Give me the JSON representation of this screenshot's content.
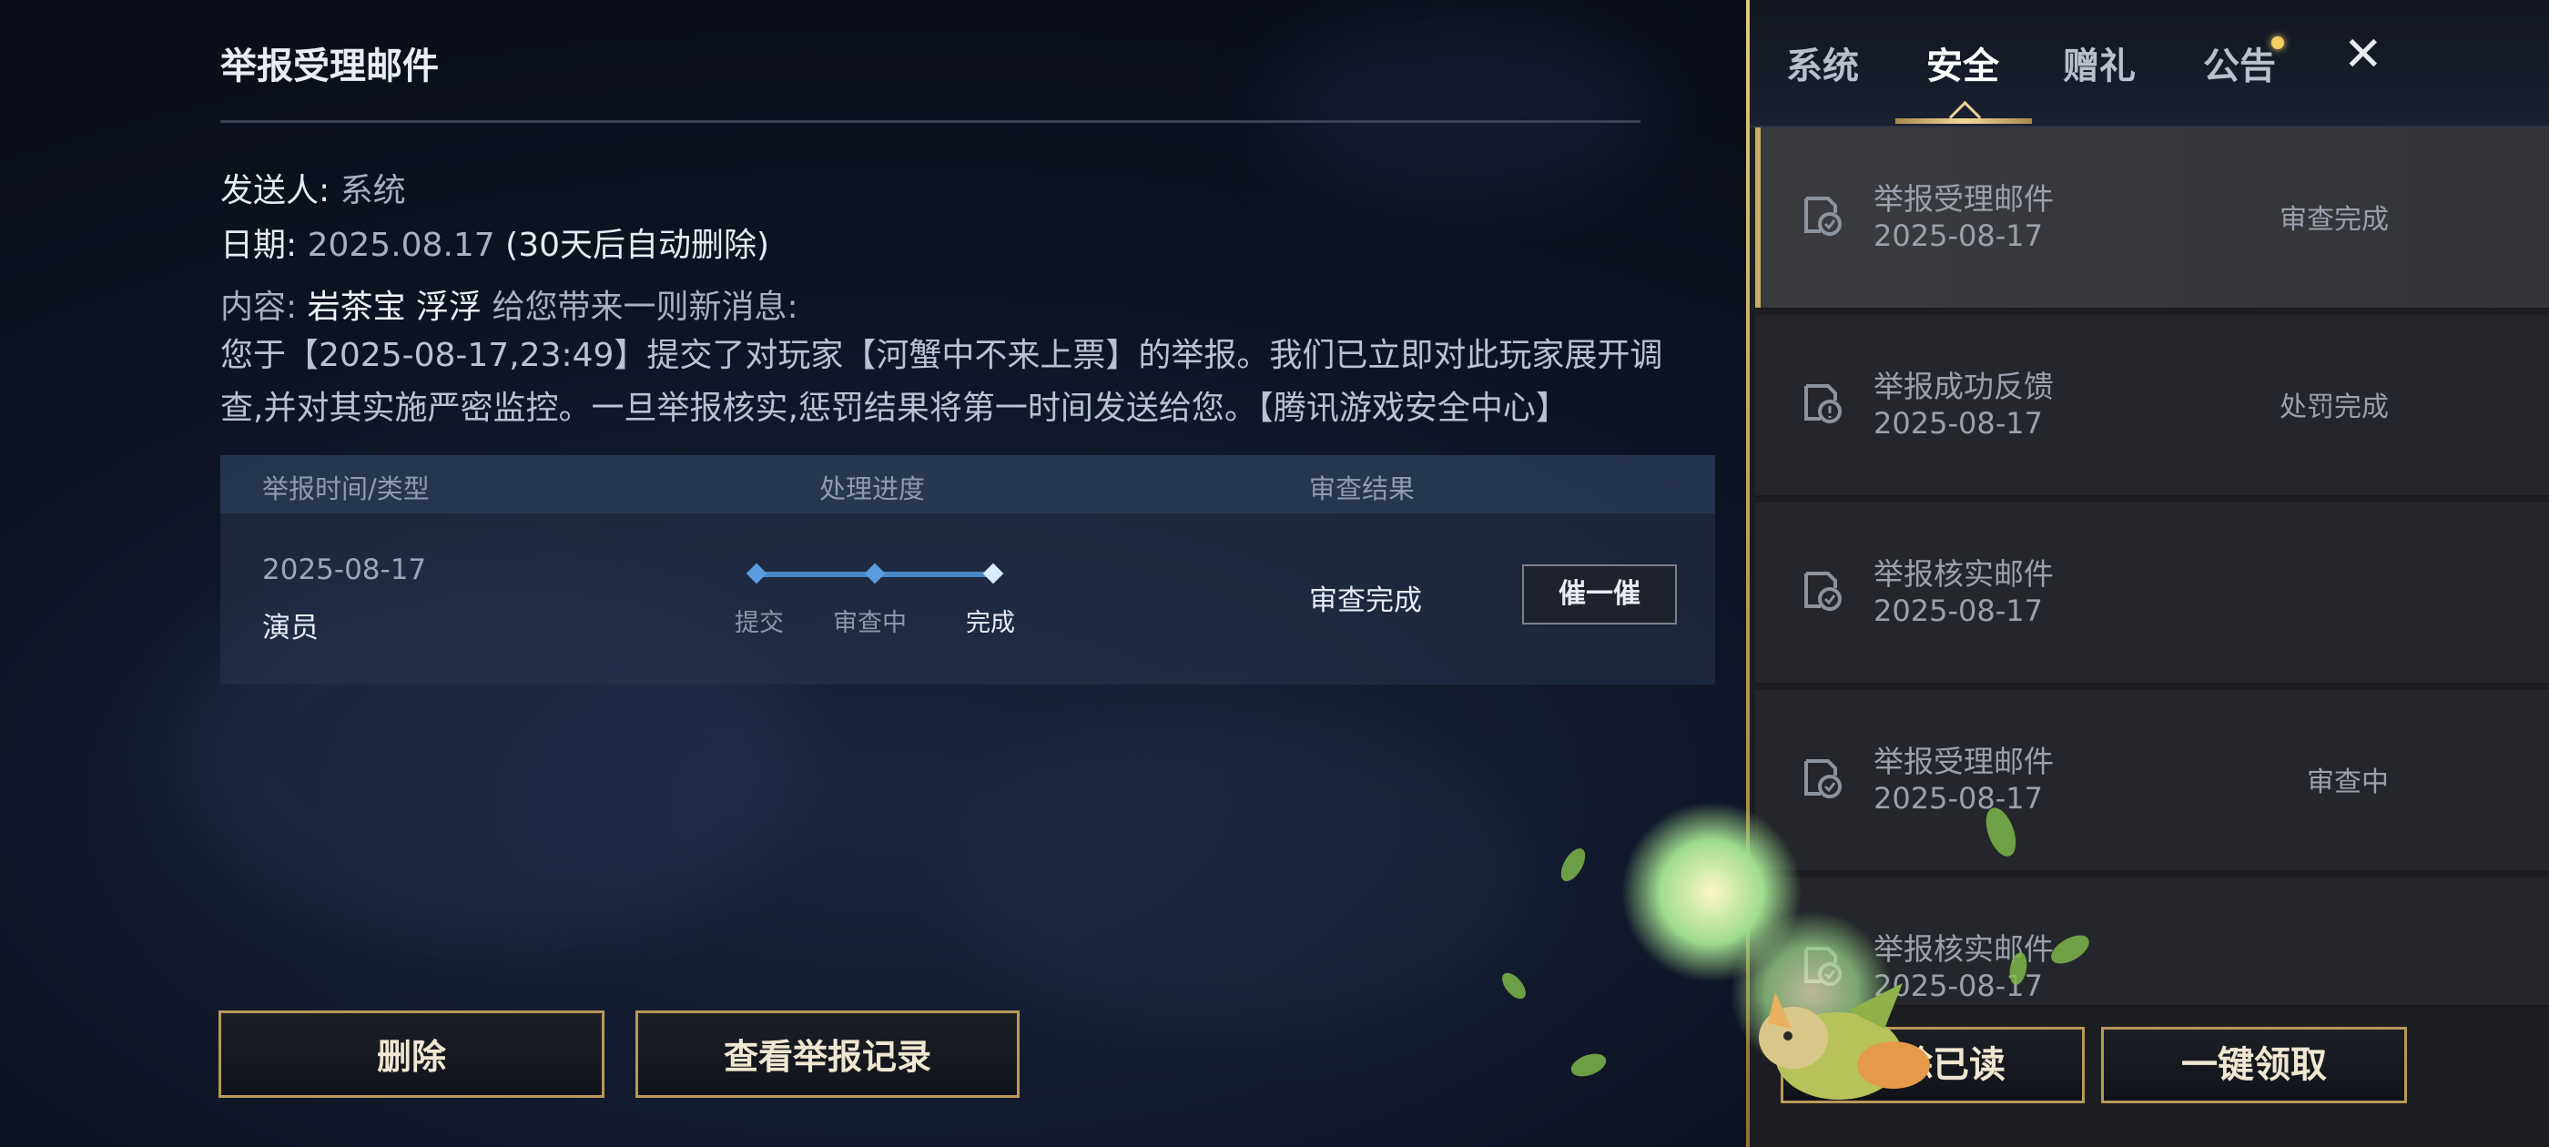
{
  "mail_detail": {
    "title": "举报受理邮件",
    "sender_label": "发送人:",
    "sender_value": "系统",
    "date_label": "日期:",
    "date_value": "2025.08.17",
    "date_note": "(30天后自动删除)",
    "content_label": "内容:",
    "content_names": "岩茶宝 浮浮",
    "content_tail": "给您带来一则新消息:",
    "body": "您于【2025-08-17,23:49】提交了对玩家【河蟹中不来上票】的举报。我们已立即对此玩家展开调查,并对其实施严密监控。一旦举报核实,惩罚结果将第一时间发送给您。【腾讯游戏安全中心】"
  },
  "report_table": {
    "headers": [
      "举报时间/类型",
      "处理进度",
      "审查结果"
    ],
    "row": {
      "date": "2025-08-17",
      "type": "演员",
      "progress_steps": [
        "提交",
        "审查中",
        "完成"
      ],
      "result": "审查完成",
      "urge_label": "催一催"
    }
  },
  "actions": {
    "delete_label": "删除",
    "view_records_label": "查看举报记录",
    "delete_read_label": "删除已读",
    "claim_all_label": "一键领取"
  },
  "tabs": [
    {
      "label": "系统",
      "active": false
    },
    {
      "label": "安全",
      "active": true
    },
    {
      "label": "赠礼",
      "active": false
    },
    {
      "label": "公告",
      "active": false
    }
  ],
  "close_label": "✕",
  "mail_list": [
    {
      "subject": "举报受理邮件",
      "date": "2025-08-17",
      "status": "审查完成",
      "icon": "mail-check-icon",
      "selected": true
    },
    {
      "subject": "举报成功反馈",
      "date": "2025-08-17",
      "status": "处罚完成",
      "icon": "mail-alert-icon",
      "selected": false
    },
    {
      "subject": "举报核实邮件",
      "date": "2025-08-17",
      "status": "",
      "icon": "mail-check-icon",
      "selected": false
    },
    {
      "subject": "举报受理邮件",
      "date": "2025-08-17",
      "status": "审查中",
      "icon": "mail-check-icon",
      "selected": false
    },
    {
      "subject": "举报核实邮件",
      "date": "2025-08-17",
      "status": "",
      "icon": "mail-check-icon",
      "selected": false
    }
  ],
  "colors": {
    "accent_gold": "#c9ab62",
    "progress_blue": "#5b9bdf",
    "panel_dark": "#1c1e22"
  }
}
